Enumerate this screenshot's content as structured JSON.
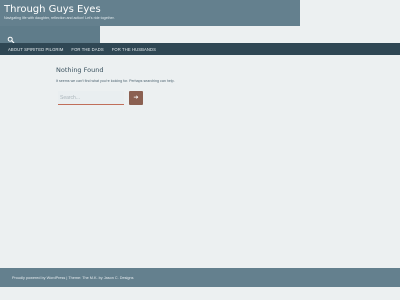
{
  "site": {
    "title": "Through Guys Eyes",
    "tagline": "Navigating life with daughter, reflection and action! Let's ride together."
  },
  "search": {
    "toggle_icon": "search-icon"
  },
  "nav": {
    "items": [
      {
        "label": "ABOUT SPIRITED PILGRIM"
      },
      {
        "label": "FOR THE DADS"
      },
      {
        "label": "FOR THE HUSBANDS"
      }
    ]
  },
  "content": {
    "title": "Nothing Found",
    "message": "It seems we can't find what you're looking for. Perhaps searching can help.",
    "search_placeholder": "Search...",
    "submit_icon": "arrow-right-icon"
  },
  "footer": {
    "credit": "Proudly powered by WordPress | Theme: The M.K. by Jason C. Designs"
  },
  "colors": {
    "header_bg": "#64808e",
    "nav_bg": "#2f4754",
    "accent": "#8b6051",
    "page_bg": "#ecf0f1"
  }
}
